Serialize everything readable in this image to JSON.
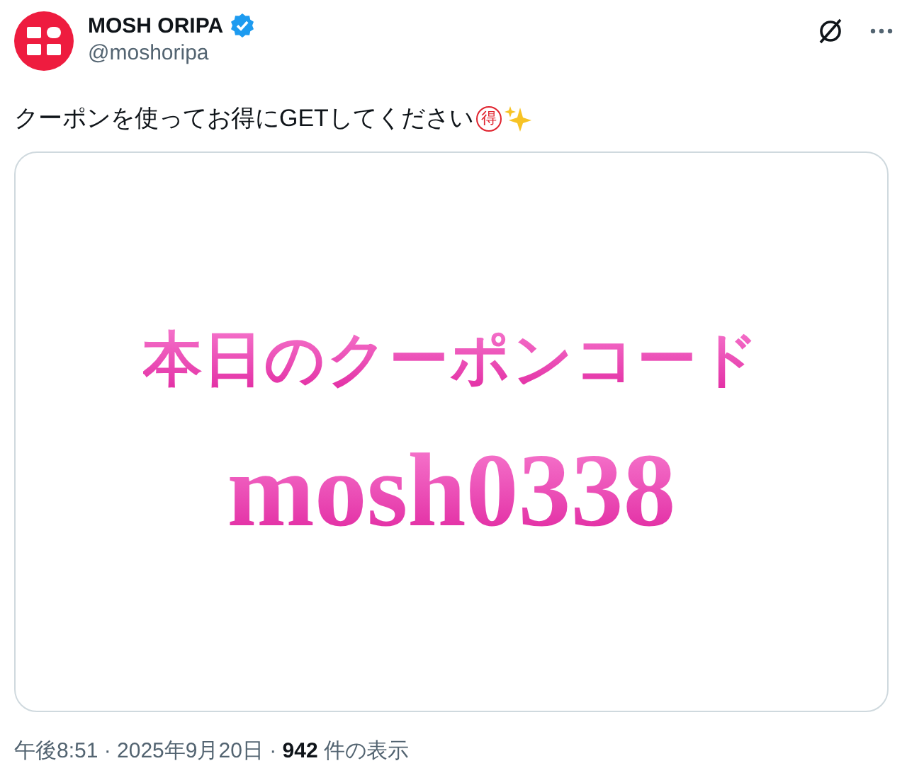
{
  "author": {
    "name": "MOSH ORIPA",
    "verified": true,
    "handle": "@moshoripa"
  },
  "post": {
    "text": "クーポンを使ってお得にGETしてください",
    "badge": "得"
  },
  "image": {
    "title": "本日のクーポンコード",
    "code": "mosh0338"
  },
  "meta": "午後8:51 · 2025年9月20日 · **942** 件の表示"
}
